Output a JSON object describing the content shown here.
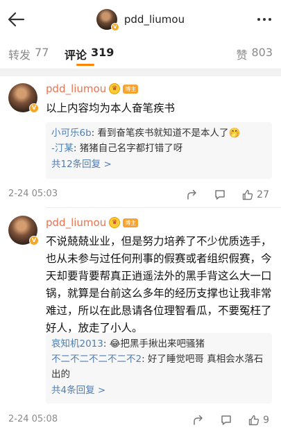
{
  "header": {
    "title": "pdd_liumou",
    "back_icon": "back-arrow-icon",
    "more_icon": "more-dots-icon"
  },
  "tabs": {
    "repost_label": "转发",
    "repost_count": "77",
    "comment_label": "评论",
    "comment_count": "319",
    "like_label": "赞",
    "like_count": "803"
  },
  "colors": {
    "accent": "#ff8200",
    "username": "#eb7350",
    "link": "#507daf"
  },
  "comments": [
    {
      "user": "pdd_liumou",
      "badge": "博主",
      "text": "以上内容均为本人奋笔疾书",
      "replies": [
        {
          "name": "小可乐6b",
          "text": ": 看到奋笔疾书就知道不是本人了🤭"
        },
        {
          "name": "-汀某",
          "text": ": 猪猪自己名字都打错了呀"
        }
      ],
      "more": "共12条回复 >",
      "date": "2-24 05:03",
      "like_count": "27"
    },
    {
      "user": "pdd_liumou",
      "badge": "博主",
      "text": "不说兢兢业业，但是努力培养了不少优质选手，也从未参与过任何刑事的假赛或者组织假赛，今天却要背要帮真正逍遥法外的黑手背这么大一口锅，就算是台前这么多年的经历支撑也让我非常难过，所以在此恳请各位理智看瓜，不要冤枉了好人，放走了小人。",
      "replies": [
        {
          "name": "哀知机2013",
          "text": ": 😂把黑手揪出来吧骚猪"
        },
        {
          "name": "不二不二不二不二不2",
          "text": ": 好了睡觉吧哥 真相会水落石出的"
        }
      ],
      "more": "共4条回复 >",
      "date": "2-24 05:08",
      "like_count": "9"
    }
  ]
}
